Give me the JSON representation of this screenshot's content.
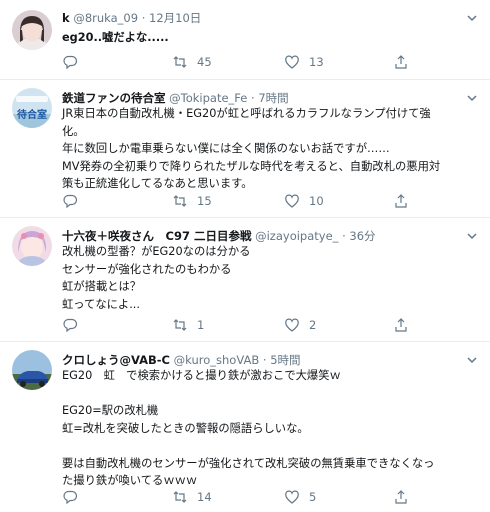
{
  "colors": {
    "text": "#14171a",
    "muted": "#657786",
    "divider": "#e6ecf0",
    "background": "#ffffff"
  },
  "icons": {
    "reply": "speech-bubble-icon",
    "retweet": "retweet-arrows-icon",
    "like": "heart-icon",
    "share": "upload-arrow-icon",
    "menu": "chevron-down-icon"
  },
  "tweets": [
    {
      "display_name": "k",
      "handle": "@8ruka_09",
      "separator": "·",
      "time": "12月10日",
      "lines": [
        "eg20..嘘だよな....."
      ],
      "retweets": "45",
      "likes": "13"
    },
    {
      "display_name": "鉄道ファンの待合室",
      "handle": "@Tokipate_Fe",
      "separator": "·",
      "time": "7時間",
      "avatar_text": "待合室",
      "lines": [
        "JR東日本の自動改札機・EG20が虹と呼ばれるカラフルなランプ付けて強",
        "化。",
        "年に数回しか電車乗らない僕には全く関係のないお話ですが……",
        "MV発券の全初乗りで降りられたザルな時代を考えると、自動改札の悪用対",
        "策も正統進化してるなあと思います。"
      ],
      "retweets": "15",
      "likes": "10"
    },
    {
      "display_name": "十六夜＋咲夜さん　C97 二日目参戦",
      "handle": "@izayoipatye_",
      "separator": "·",
      "time": "36分",
      "lines": [
        "改札機の型番？がEG20なのは分かる",
        "センサーが強化されたのもわかる",
        "虹が搭載とは？",
        "虹ってなによ..."
      ],
      "retweets": "1",
      "likes": "2"
    },
    {
      "display_name": "クロしょう@VAB-C",
      "handle": "@kuro_shoVAB",
      "separator": "·",
      "time": "5時間",
      "lines": [
        "EG20　虹　で検索かけると撮り鉄が激おこで大爆笑ｗ",
        "",
        "EG20=駅の改札機",
        "虹=改札を突破したときの警報の隠語らしいな。",
        "",
        "要は自動改札機のセンサーが強化されて改札突破の無賃乗車できなくなっ",
        "た撮り鉄が喚いてるｗｗｗ"
      ],
      "retweets": "14",
      "likes": "5"
    }
  ]
}
